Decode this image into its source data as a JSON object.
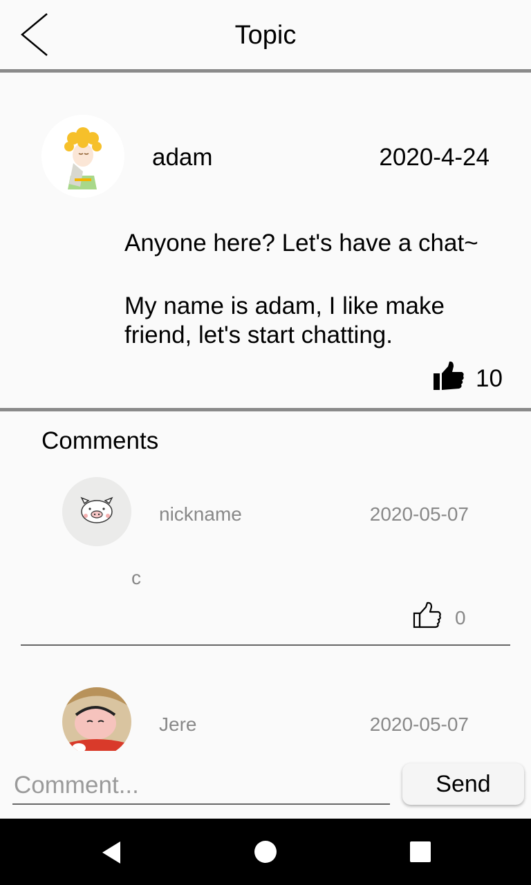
{
  "header": {
    "title": "Topic",
    "back_icon": "chevron-left-icon"
  },
  "post": {
    "author": "adam",
    "date": "2020-4-24",
    "title": "Anyone here? Let's have a chat~",
    "body": "My name is adam, I like make friend, let's start chatting.",
    "likes": "10",
    "like_icon": "thumbs-up-filled-icon"
  },
  "comments": {
    "heading": "Comments",
    "items": [
      {
        "name": "nickname",
        "date": "2020-05-07",
        "text": "c",
        "likes": "0",
        "like_icon": "thumbs-up-outline-icon",
        "avatar": "pig-avatar"
      },
      {
        "name": "Jere",
        "date": "2020-05-07",
        "avatar": "cartoon-boy-avatar"
      }
    ]
  },
  "composer": {
    "placeholder": "Comment...",
    "value": "",
    "send_label": "Send"
  },
  "navbar": {
    "back_icon": "triangle-back-icon",
    "home_icon": "circle-home-icon",
    "recents_icon": "square-recents-icon"
  }
}
